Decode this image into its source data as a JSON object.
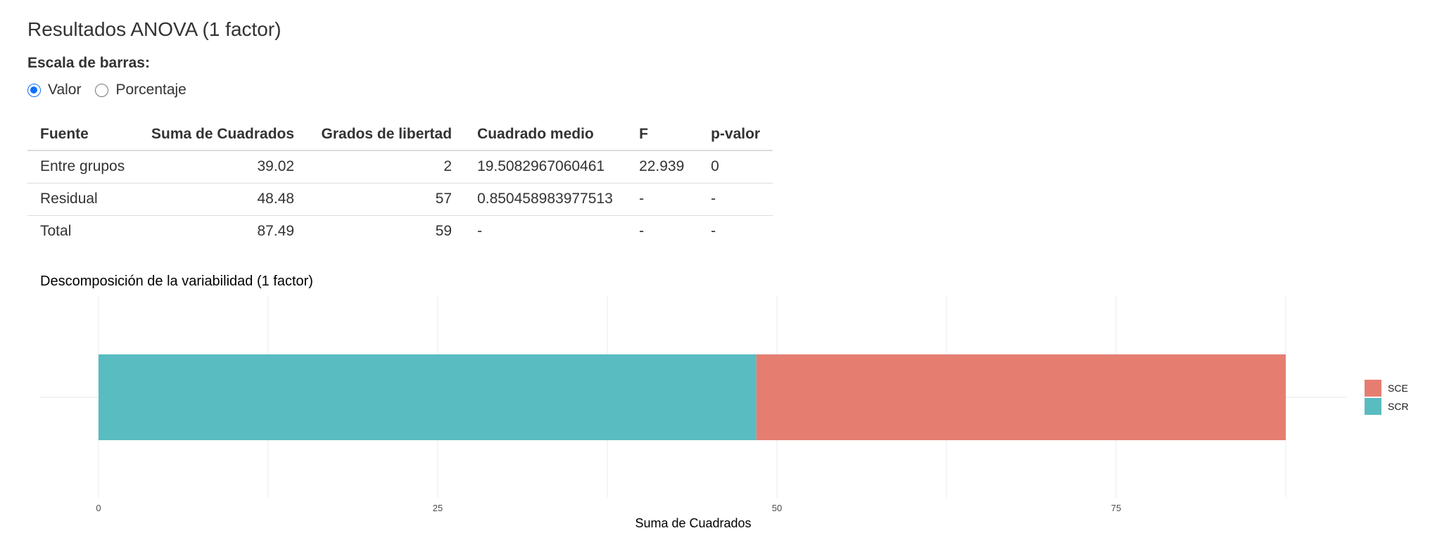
{
  "page": {
    "title": "Resultados ANOVA (1 factor)",
    "scale_label": "Escala de barras:",
    "radio_options": [
      {
        "label": "Valor",
        "checked": true
      },
      {
        "label": "Porcentaje",
        "checked": false
      }
    ]
  },
  "table": {
    "headers": [
      "Fuente",
      "Suma de Cuadrados",
      "Grados de libertad",
      "Cuadrado medio",
      "F",
      "p-valor"
    ],
    "rows": [
      [
        "Entre grupos",
        "39.02",
        "2",
        "19.5082967060461",
        "22.939",
        "0"
      ],
      [
        "Residual",
        "48.48",
        "57",
        "0.850458983977513",
        "-",
        "-"
      ],
      [
        "Total",
        "87.49",
        "59",
        "-",
        "-",
        "-"
      ]
    ]
  },
  "chart_data": {
    "type": "bar",
    "orientation": "horizontal",
    "stacked": true,
    "title": "Descomposición de la variabilidad (1 factor)",
    "xlabel": "Suma de Cuadrados",
    "ylabel": "",
    "xlim": [
      0,
      92
    ],
    "x_ticks": [
      0,
      25,
      50,
      75
    ],
    "grid": true,
    "legend_position": "right",
    "series": [
      {
        "name": "SCR",
        "value": 48.48,
        "color": "#58BCC1"
      },
      {
        "name": "SCE",
        "value": 39.02,
        "color": "#E57E71"
      }
    ],
    "legend": [
      {
        "name": "SCE",
        "color": "#E57E71"
      },
      {
        "name": "SCR",
        "color": "#58BCC1"
      }
    ]
  }
}
